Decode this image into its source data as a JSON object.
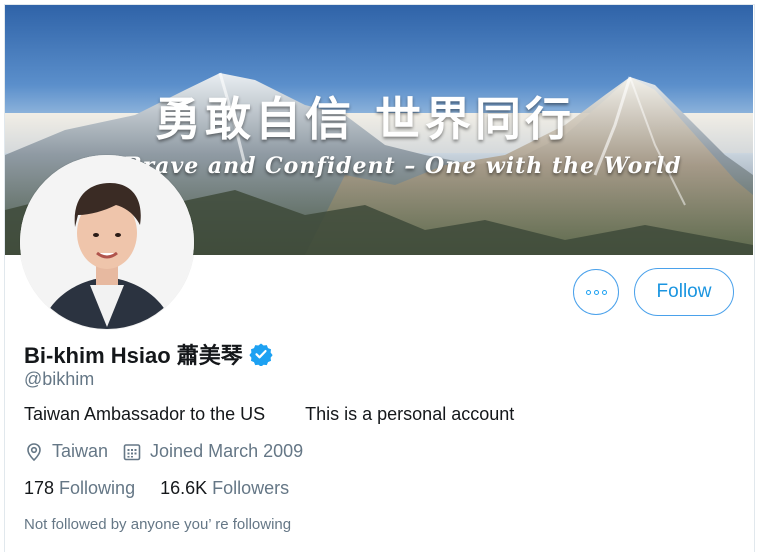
{
  "banner": {
    "chinese_slogan": "勇敢自信 世界同行",
    "english_slogan": "Brave and Confident – One with the World"
  },
  "profile": {
    "name": "Bi-khim Hsiao 蕭美琴",
    "verified": true,
    "handle": "@bikhim",
    "bio_part1": "Taiwan Ambassador to the US",
    "bio_part2": "This is a personal account",
    "location": "Taiwan",
    "joined": "Joined March 2009",
    "following_count": "178",
    "following_label": "Following",
    "followers_count": "16.6K",
    "followers_label": "Followers",
    "mutuals_note": "Not followed by anyone you’ re following"
  },
  "actions": {
    "more_icon": "more-dots-icon",
    "follow_label": "Follow"
  },
  "icons": {
    "location": "location-pin-icon",
    "calendar": "calendar-icon",
    "verified": "verified-badge-icon"
  },
  "colors": {
    "accent": "#1da1f2",
    "secondary_text": "#657786",
    "primary_text": "#14171a"
  }
}
